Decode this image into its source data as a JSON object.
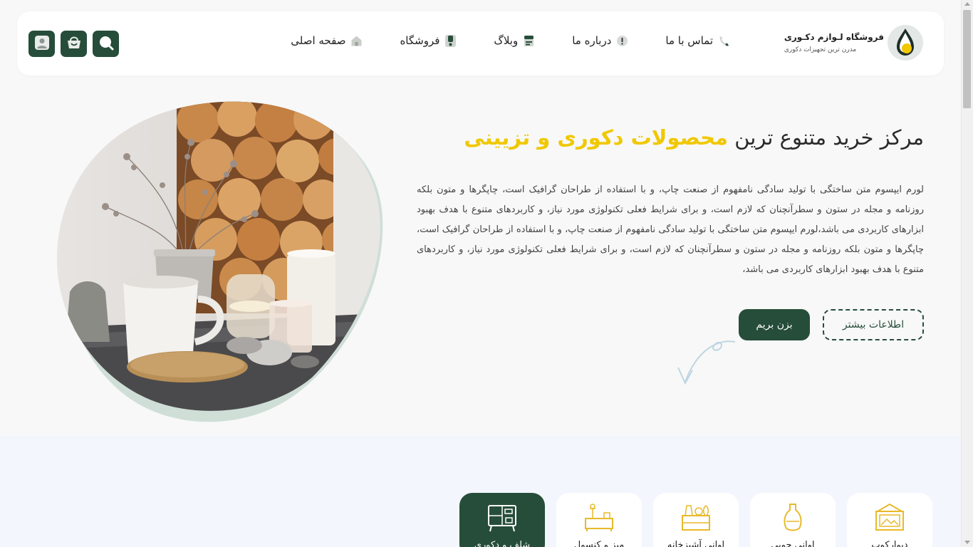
{
  "header": {
    "logo_title": "فروشگاه لـوازم دکـوری",
    "logo_subtitle": "مدرن ترین تجهیزات دکوری",
    "nav": [
      {
        "label": "صفحه اصلی",
        "icon": "home-icon"
      },
      {
        "label": "فروشگاه",
        "icon": "shop-icon"
      },
      {
        "label": "وبلاگ",
        "icon": "blog-icon"
      },
      {
        "label": "درباره ما",
        "icon": "info-icon"
      },
      {
        "label": "تماس با ما",
        "icon": "phone-icon"
      }
    ],
    "buttons": [
      "user-icon",
      "basket-icon",
      "search-icon"
    ]
  },
  "hero": {
    "title_plain": "مرکز خرید متنوع ترین",
    "title_highlight": "محصولات دکوری و تزیینی",
    "paragraph": "لورم ایپسوم متن ساختگی با تولید سادگی نامفهوم از صنعت چاپ، و با استفاده از طراحان گرافیک است، چاپگرها و متون بلکه روزنامه و مجله در ستون و سطرآنچنان که لازم است، و برای شرایط فعلی تکنولوژی مورد نیاز، و کاربردهای متنوع با هدف بهبود ابزارهای کاربردی می باشد،لورم ایپسوم متن ساختگی با تولید سادگی نامفهوم از صنعت چاپ، و با استفاده از طراحان گرافیک است، چاپگرها و متون بلکه روزنامه و مجله در ستون و سطرآنچنان که لازم است، و برای شرایط فعلی تکنولوژی مورد نیاز، و کاربردهای متنوع با هدف بهبود ابزارهای کاربردی می باشد،",
    "btn_primary": "بزن بریم",
    "btn_secondary": "اطلاعات بیشتر"
  },
  "categories": [
    {
      "label": "دیوارکوب",
      "icon": "wall-decor-icon",
      "active": false
    },
    {
      "label": "اوانی چوبی",
      "icon": "vase-icon",
      "active": false
    },
    {
      "label": "اوانی آشپزخانه",
      "icon": "kitchenware-icon",
      "active": false
    },
    {
      "label": "میز و کنسول",
      "icon": "table-console-icon",
      "active": false
    },
    {
      "label": "شلف و دکوری",
      "icon": "shelf-icon",
      "active": true
    }
  ],
  "colors": {
    "brand_green": "#264d3a",
    "accent_yellow": "#f0c800",
    "background": "#f8f8f8",
    "band": "#f3f6fd"
  }
}
